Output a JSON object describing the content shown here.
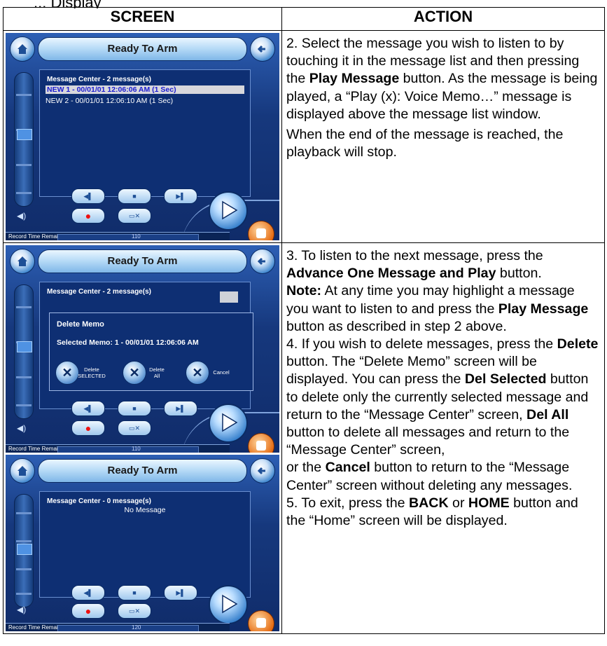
{
  "top_fragment": "... Display",
  "headers": {
    "screen": "SCREEN",
    "action": "ACTION"
  },
  "screens": {
    "s1": {
      "title": "Ready To Arm",
      "list_title": "Message Center - 2 message(s)",
      "messages": [
        "NEW 1  -  00/01/01 12:06:06 AM (1 Sec)",
        "NEW 2  -  00/01/01 12:06:10 AM (1 Sec)"
      ],
      "footer_label": "Record Time Remaining",
      "footer_value": "110"
    },
    "s2": {
      "title": "Ready To Arm",
      "list_title": "Message Center - 2 message(s)",
      "dialog_title": "Delete Memo",
      "dialog_selected": "Selected Memo: 1  -  00/01/01 12:06:06 AM",
      "btn_del_selected": "Delete SELECTED",
      "btn_del_all": "Delete All",
      "btn_cancel": "Cancel",
      "footer_label": "Record Time Remaining",
      "footer_value": "110"
    },
    "s3": {
      "title": "Ready To Arm",
      "list_title": "Message Center - 0 message(s)",
      "empty_text": "No Message",
      "footer_label": "Record Time Remaining",
      "footer_value": "120"
    }
  },
  "actions": {
    "a2_p1_pre": "2.  Select the message you wish to listen to by touching it in the message list and then pressing the ",
    "a2_p1_b": "Play Message",
    "a2_p1_post": " button. As the message is being played, a “Play (x): Voice Memo…” message is displayed above the message list window.",
    "a2_p2": "When the end of the message is reached, the playback will stop.",
    "a3_pre": "3.  To listen to the next message, press the ",
    "a3_b": "Advance One Message and Play",
    "a3_post": " button.",
    "note_label": "Note:",
    "note_pre": " At any time you may highlight a message you want to listen to and press the ",
    "note_b": "Play Message",
    "note_post": " button as described in step 2 above.",
    "a4_pre": "4.  If you wish to delete messages, press the ",
    "a4_b1": "Delete",
    "a4_m1": " button. The “Delete Memo” screen will be displayed. You can press the ",
    "a4_b2": "Del Selected",
    "a4_m2": " button to delete only the currently selected message and return to the “Message Center” screen, ",
    "a4_b3": "Del All",
    "a4_m3": " button to delete all messages and return to the “Message Center” screen,",
    "a4_l2_pre": "or the ",
    "a4_b4": "Cancel",
    "a4_l2_post": " button to return to the “Message Center” screen without deleting any messages.",
    "a5_pre": "5.  To exit, press the ",
    "a5_b1": "BACK",
    "a5_mid": " or ",
    "a5_b2": "HOME",
    "a5_post": " button and the “Home” screen will be displayed."
  }
}
